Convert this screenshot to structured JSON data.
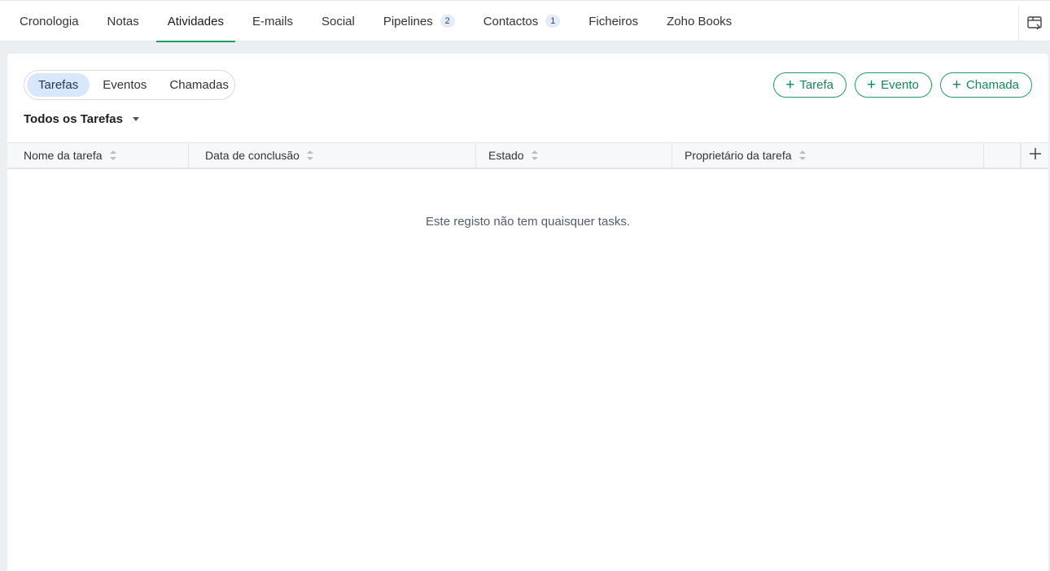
{
  "tabs": [
    {
      "label": "Cronologia"
    },
    {
      "label": "Notas"
    },
    {
      "label": "Atividades",
      "active": true
    },
    {
      "label": "E-mails"
    },
    {
      "label": "Social"
    },
    {
      "label": "Pipelines",
      "count": "2"
    },
    {
      "label": "Contactos",
      "count": "1"
    },
    {
      "label": "Ficheiros"
    },
    {
      "label": "Zoho Books"
    }
  ],
  "segment": {
    "tarefas": "Tarefas",
    "eventos": "Eventos",
    "chamadas": "Chamadas"
  },
  "buttons": {
    "tarefa": "Tarefa",
    "evento": "Evento",
    "chamada": "Chamada",
    "plus": "+"
  },
  "filter": {
    "label": "Todos os Tarefas"
  },
  "table": {
    "columns": [
      "Nome da tarefa",
      "Data de conclusão",
      "Estado",
      "Proprietário da tarefa"
    ],
    "add_column": "+"
  },
  "empty_message": "Este registo não tem quaisquer tasks.",
  "colors": {
    "accent": "#1f9d63",
    "segment_active_bg": "#d8e8fa"
  },
  "icons": {
    "top_right": "panel-toggle-icon",
    "sort": "sort-icon",
    "dropdown": "caret-down-icon"
  }
}
